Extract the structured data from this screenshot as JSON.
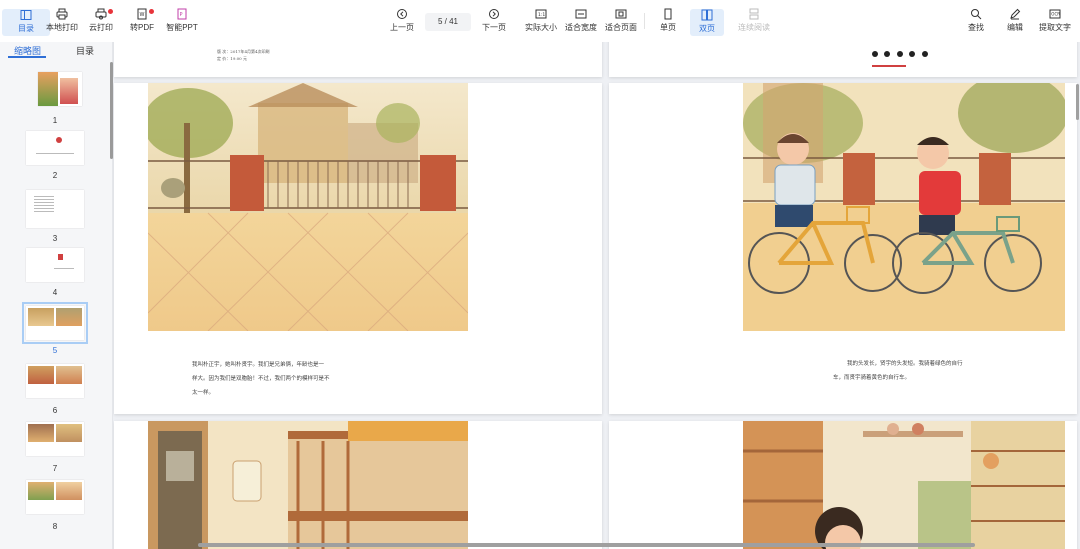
{
  "toolbar": {
    "catalog": "目录",
    "local_print": "本地打印",
    "cloud_print": "云打印",
    "to_pdf": "转PDF",
    "smart_ppt": "智能PPT",
    "prev_page": "上一页",
    "page_indicator": "5  / 41",
    "next_page": "下一页",
    "actual_size": "实际大小",
    "fit_width": "适合宽度",
    "fit_page": "适合页面",
    "single_page": "单页",
    "double_page": "双页",
    "continuous_read": "连续阅读",
    "find": "查找",
    "edit": "编辑",
    "extract_text": "提取文字"
  },
  "sidebar": {
    "tabs": {
      "thumbnails": "缩略图",
      "outline": "目录"
    },
    "thumbs": [
      {
        "num": "1"
      },
      {
        "num": "2"
      },
      {
        "num": "3"
      },
      {
        "num": "4"
      },
      {
        "num": "5"
      },
      {
        "num": "6"
      },
      {
        "num": "7"
      },
      {
        "num": "8"
      }
    ]
  },
  "pages": {
    "top_left_lines": [
      "版    次：2017年4月第4次印刷",
      "定    价：19.00 元"
    ],
    "left_text": [
      "我叫朴正宇，她叫朴贤宇。我们是兄弟俩，年龄也是一",
      "样大。因为我们是双胞胎！不过，我们两个的模样可是不",
      "太一样。"
    ],
    "right_text": [
      "我的头发长，贤宇的头发短。我骑着绿色的自行",
      "车，而贤宇骑着黄色的自行车。"
    ]
  },
  "colors": {
    "accent": "#2f6fd6",
    "badge": "#e8333a"
  }
}
